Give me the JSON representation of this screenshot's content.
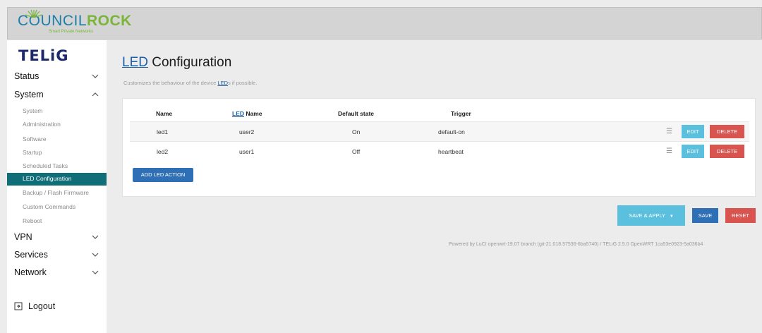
{
  "brand": {
    "name_part1": "COUNCIL",
    "name_part2": "ROCK",
    "tagline": "Smart Private Networks",
    "primary_color": "#1d7fa8",
    "secondary_color": "#7ab53a"
  },
  "sidebar": {
    "product": "TELiG",
    "menus": [
      {
        "label": "Status",
        "icon": "chevron-down-icon"
      },
      {
        "label": "System",
        "icon": "chevron-up-icon"
      },
      {
        "label": "VPN",
        "icon": "chevron-down-icon"
      },
      {
        "label": "Services",
        "icon": "chevron-down-icon"
      },
      {
        "label": "Network",
        "icon": "chevron-down-icon"
      }
    ],
    "system_items": [
      "System",
      "Administration",
      "Software",
      "Startup",
      "Scheduled Tasks",
      "LED Configuration",
      "Backup / Flash Firmware",
      "Custom Commands",
      "Reboot"
    ],
    "active_item": "LED Configuration",
    "active_color": "#0f6e78",
    "logout": "Logout"
  },
  "page": {
    "title_abbr": "LED",
    "title_rest": " Configuration",
    "desc_pre": "Customizes the behaviour of the device ",
    "desc_abbr": "LED",
    "desc_post": "s if possible."
  },
  "table": {
    "headers": {
      "name": "Name",
      "led_abbr": "LED",
      "led_rest": " Name",
      "default_state": "Default state",
      "trigger": "Trigger"
    },
    "rows": [
      {
        "name": "led1",
        "led_name": "user2",
        "default_state": "On",
        "trigger": "default-on"
      },
      {
        "name": "led2",
        "led_name": "user1",
        "default_state": "Off",
        "trigger": "heartbeat"
      }
    ],
    "edit_label": "EDIT",
    "delete_label": "DELETE",
    "add_label": "ADD LED ACTION"
  },
  "actions": {
    "save_apply": "SAVE & APPLY",
    "save": "SAVE",
    "reset": "RESET"
  },
  "footer": "Powered by LuCI openwrt-19.07 branch (git-21.018.57536-6ba5740) / TELiG 2.5.0 OpenWRT 1ca53e0923-5a036b4"
}
